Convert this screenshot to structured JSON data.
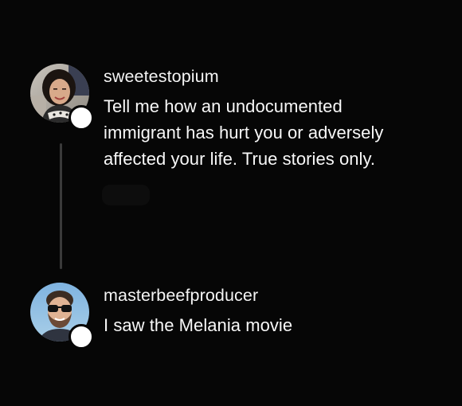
{
  "thread": {
    "posts": [
      {
        "username": "sweetestopium",
        "text_lines": [
          "Tell me how an undocumented",
          "immigrant has hurt you or adversely",
          "affected your life. True stories only."
        ],
        "avatar_icon": "avatar-woman-photo-icon"
      },
      {
        "username": "masterbeefproducer",
        "text_lines": [
          "I saw the Melania movie"
        ],
        "avatar_icon": "avatar-man-sunglasses-icon"
      }
    ]
  },
  "colors": {
    "background": "#060606",
    "text": "#f4f4f4",
    "connector": "#3a3a3a",
    "badge": "#ffffff"
  }
}
